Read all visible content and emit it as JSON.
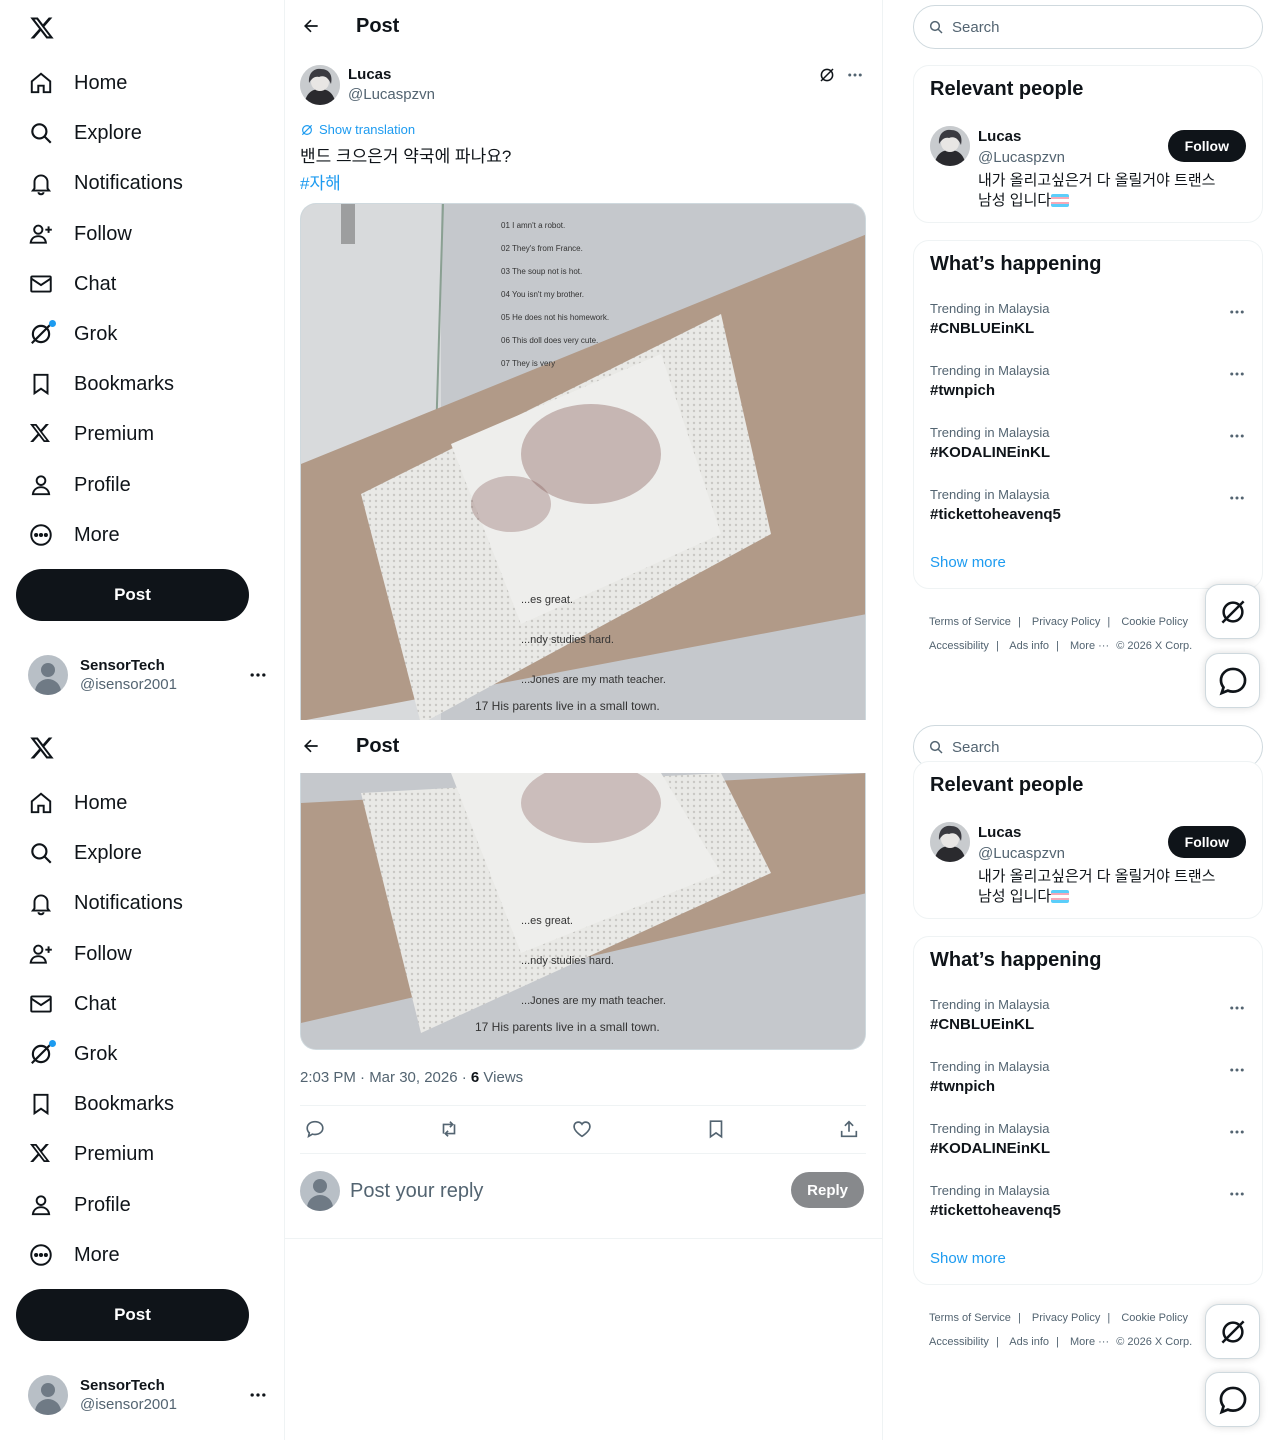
{
  "nav": {
    "items": [
      {
        "label": "Home",
        "icon": "home-icon"
      },
      {
        "label": "Explore",
        "icon": "search-icon"
      },
      {
        "label": "Notifications",
        "icon": "bell-icon"
      },
      {
        "label": "Follow",
        "icon": "person-add-icon"
      },
      {
        "label": "Chat",
        "icon": "mail-icon"
      },
      {
        "label": "Grok",
        "icon": "grok-icon"
      },
      {
        "label": "Bookmarks",
        "icon": "bookmark-icon"
      },
      {
        "label": "Premium",
        "icon": "x-logo-icon"
      },
      {
        "label": "Profile",
        "icon": "person-icon"
      },
      {
        "label": "More",
        "icon": "more-circle-icon"
      }
    ],
    "post_label": "Post",
    "account": {
      "name": "SensorTech",
      "handle": "@isensor2001"
    }
  },
  "header": {
    "title": "Post"
  },
  "post": {
    "author_name": "Lucas",
    "author_handle": "@Lucaspzvn",
    "show_translation": "Show translation",
    "text": "밴드 크으은거 약국에 파나요?",
    "hashtag": "#자해",
    "image_lines": [
      "01 I amn't a robot.",
      "02 They's from France.",
      "03 The soup not is hot.",
      "04 You isn't my brother.",
      "05 He does not his homework.",
      "06 This doll does very cute.",
      "07 They is very",
      "...es great.",
      "...ndy studies hard.",
      "...Jones are my math teacher.",
      "17 His parents live in a small town."
    ],
    "time": "2:03 PM · Mar 30, 2026 · ",
    "views_count": "6",
    "views_label": " Views"
  },
  "reply": {
    "placeholder": "Post your reply",
    "button": "Reply"
  },
  "search": {
    "placeholder": "Search"
  },
  "relevant": {
    "title": "Relevant people",
    "name": "Lucas",
    "handle": "@Lucaspzvn",
    "follow": "Follow",
    "bio_line1": "내가 올리고싶은거 다 올릴거야 트랜스",
    "bio_line2": "남성 입니다"
  },
  "trends": {
    "title": "What’s happening",
    "items": [
      {
        "category": "Trending in Malaysia",
        "tag": "#CNBLUEinKL"
      },
      {
        "category": "Trending in Malaysia",
        "tag": "#twnpich"
      },
      {
        "category": "Trending in Malaysia",
        "tag": "#KODALINEinKL"
      },
      {
        "category": "Trending in Malaysia",
        "tag": "#tickettoheavenq5"
      }
    ],
    "show_more": "Show more"
  },
  "footer": {
    "terms": "Terms of Service",
    "privacy": "Privacy Policy",
    "cookie": "Cookie Policy",
    "accessibility": "Accessibility",
    "ads": "Ads info",
    "more": "More ···",
    "copyright": "© 2026 X Corp."
  },
  "colors": {
    "accent": "#1d9bf0",
    "text": "#0f1419",
    "muted": "#536471",
    "button_dark": "#0f1419"
  }
}
